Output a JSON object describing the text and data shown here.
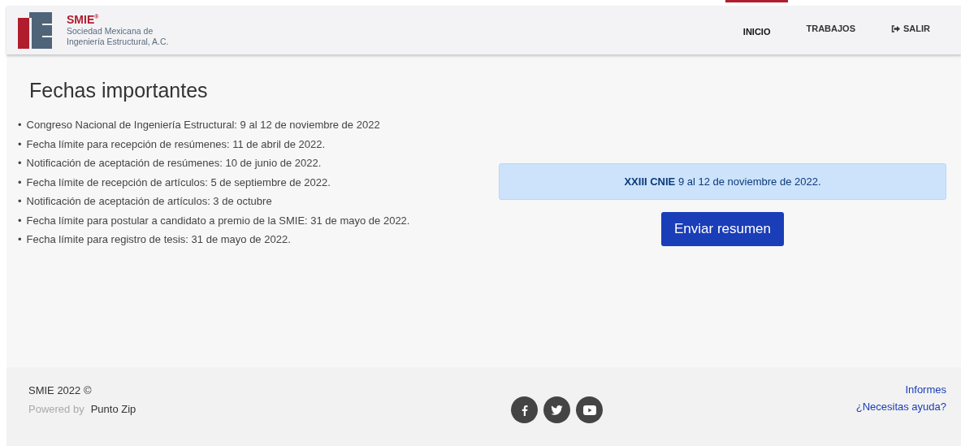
{
  "header": {
    "logo": {
      "name": "SMIE",
      "mark": "®",
      "subtitle_lines": [
        "Sociedad Mexicana de",
        "Ingeniería Estructural, A.C."
      ]
    },
    "nav": [
      {
        "label": "INICIO",
        "selected": true,
        "kind": "text"
      },
      {
        "label": "TRABAJOS",
        "selected": false,
        "kind": "text"
      },
      {
        "label": "SALIR",
        "selected": false,
        "kind": "logout"
      }
    ]
  },
  "main": {
    "title": "Fechas importantes",
    "bullet": "•",
    "dates": [
      "Congreso Nacional de Ingeniería Estructural: 9 al 12 de noviembre de 2022",
      "Fecha límite para recepción de resúmenes: 11 de abril de 2022.",
      "Notificación de aceptación de resúmenes: 10 de junio de 2022.",
      "Fecha límite de recepción de artículos: 5 de septiembre de 2022.",
      "Notificación de aceptación de artículos: 3 de octubre",
      "Fecha límite para postular a candidato a premio de la SMIE: 31 de mayo de 2022.",
      "Fecha límite para registro de tesis: 31 de mayo de 2022."
    ],
    "notice": "**XXIII CNIE** 9 al 12 de noviembre de 2022.",
    "button": "Enviar resumen"
  },
  "footer": {
    "copyright": "SMIE 2022 ©",
    "powered_label": "Powered by",
    "powered_link": "Punto Zip",
    "social": [
      {
        "kind": "facebook"
      },
      {
        "kind": "twitter"
      },
      {
        "kind": "youtube"
      }
    ],
    "links": [
      "Informes",
      "¿Necesitas ayuda?"
    ]
  }
}
